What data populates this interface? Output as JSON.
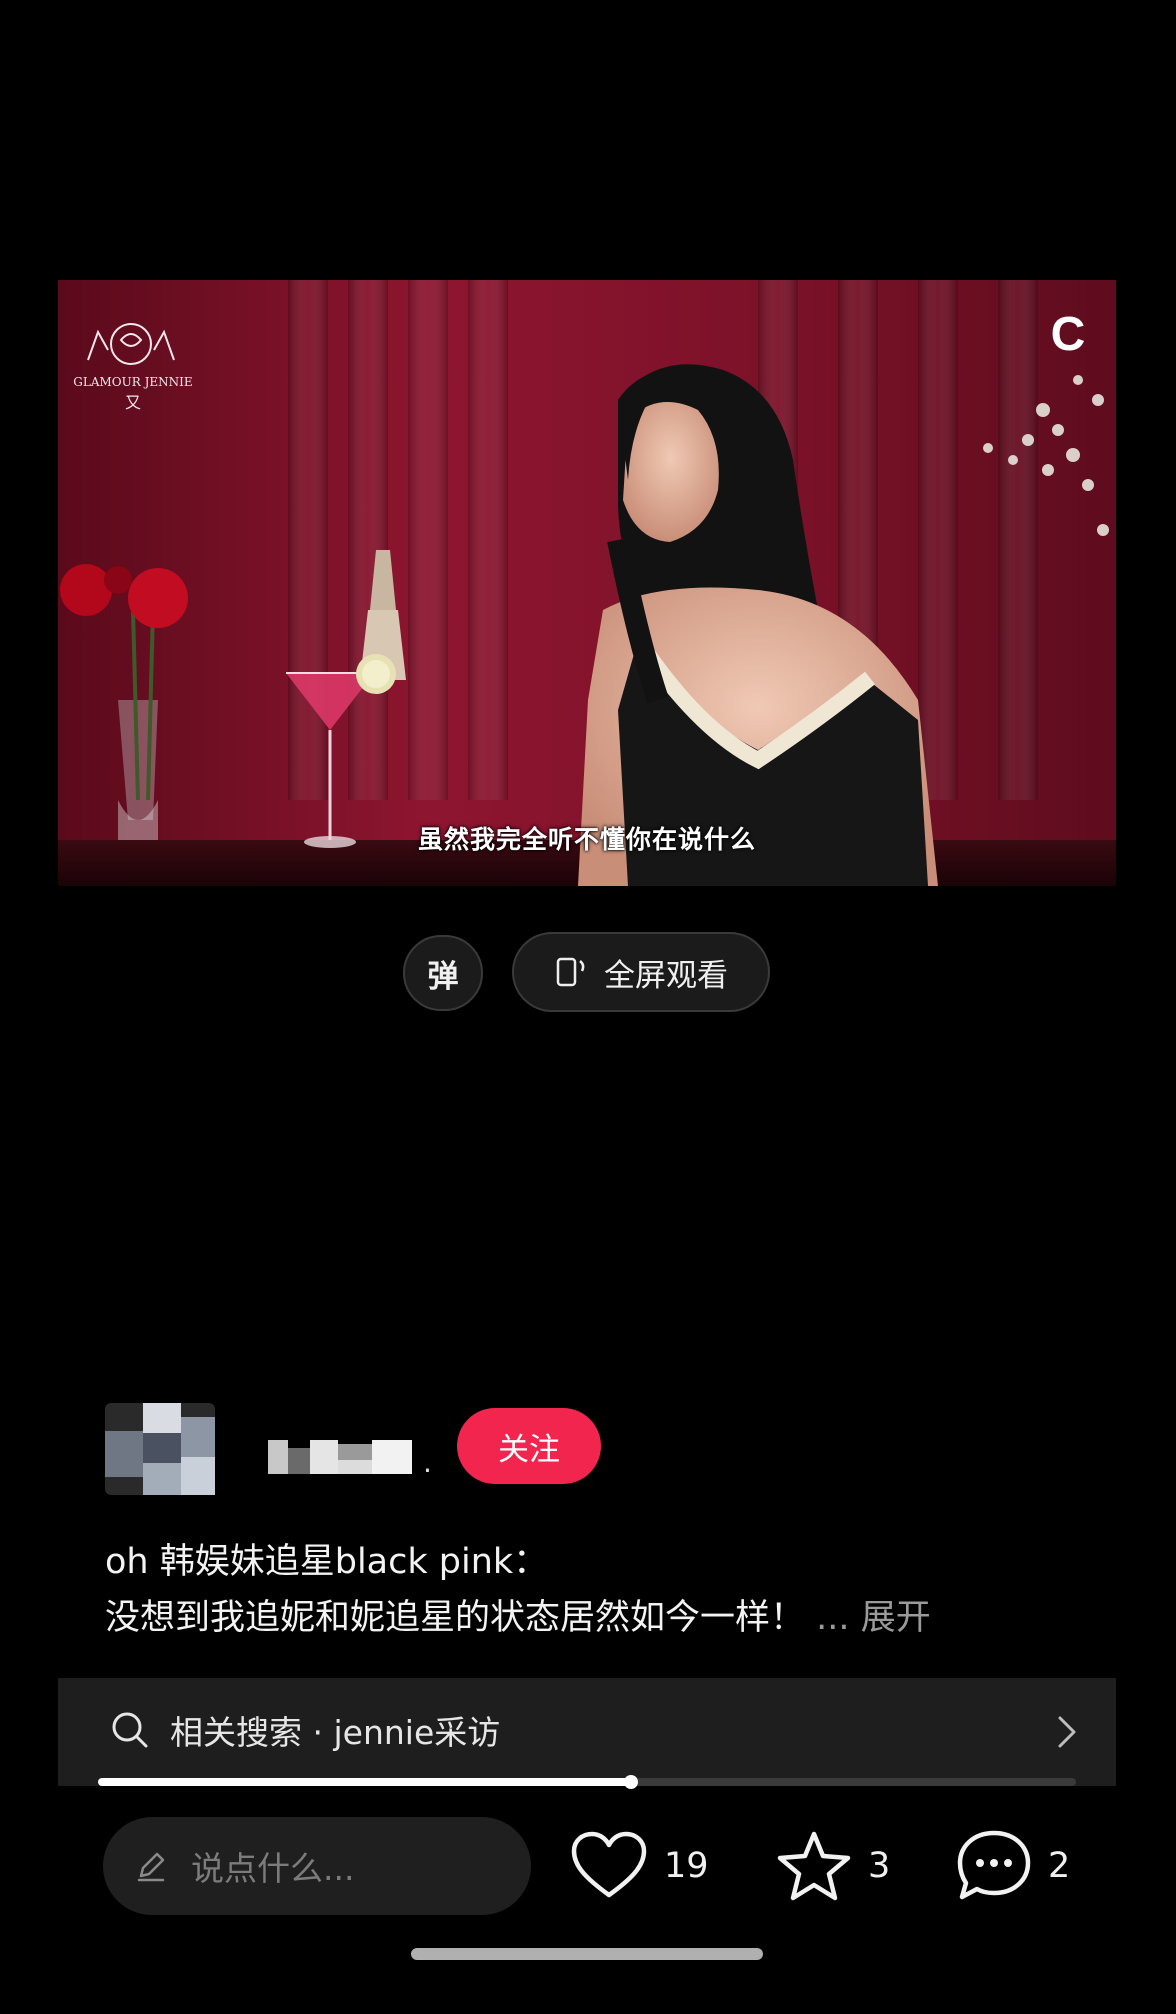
{
  "video": {
    "brand_name": "GLAMOUR JENNIE",
    "brand_mark": "又",
    "channel_badge": "C",
    "subtitle": "虽然我完全听不懂你在说什么"
  },
  "controls": {
    "danmaku_label": "弹",
    "fullscreen_label": "全屏观看"
  },
  "author": {
    "follow_label": "关注",
    "name_separator": "."
  },
  "caption": {
    "line1": "oh 韩娱妹追星black pink：",
    "line2": "没想到我追妮和妮追星的状态居然如今一样！",
    "ellipsis": "...",
    "expand_label": "展开"
  },
  "related_search": {
    "label": "相关搜索 · jennie采访"
  },
  "progress": {
    "fraction": 0.545
  },
  "bottom_bar": {
    "comment_placeholder": "说点什么...",
    "likes": "19",
    "favorites": "3",
    "comments": "2"
  },
  "colors": {
    "follow_button": "#f2254e",
    "background": "#000000"
  },
  "icons": {
    "danmaku": "danmaku-icon",
    "fullscreen": "rotate-phone-icon",
    "search": "search-icon",
    "chevron": "chevron-right-icon",
    "pencil": "pencil-icon",
    "like": "heart-icon",
    "favorite": "star-icon",
    "comment": "speech-bubble-icon"
  }
}
